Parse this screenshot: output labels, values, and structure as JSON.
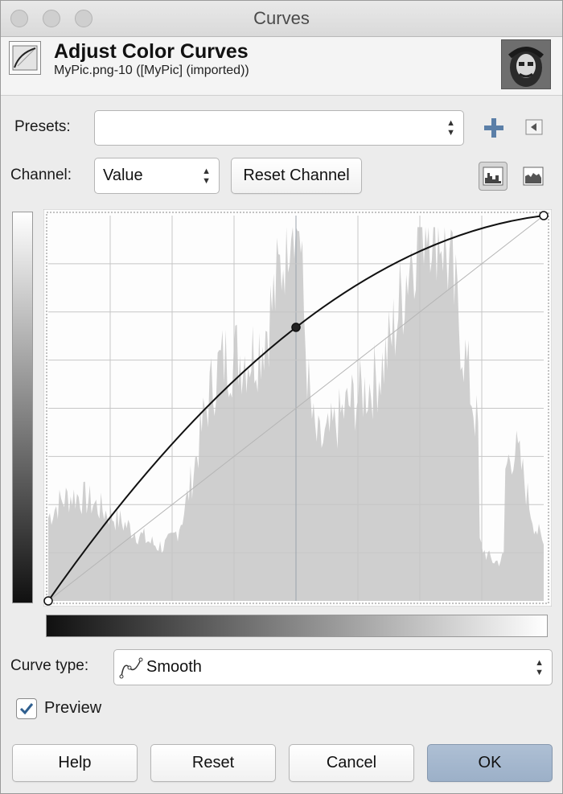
{
  "window": {
    "title": "Curves"
  },
  "header": {
    "title": "Adjust Color Curves",
    "subtitle": "MyPic.png-10 ([MyPic] (imported))"
  },
  "presets": {
    "label": "Presets:",
    "value": ""
  },
  "channel": {
    "label": "Channel:",
    "value": "Value",
    "reset_label": "Reset Channel"
  },
  "curve_type": {
    "label": "Curve type:",
    "value": "Smooth"
  },
  "preview": {
    "label": "Preview",
    "checked": true
  },
  "buttons": {
    "help": "Help",
    "reset": "Reset",
    "cancel": "Cancel",
    "ok": "OK"
  },
  "curve": {
    "control_points": [
      [
        0,
        0
      ],
      [
        0.5,
        0.71
      ],
      [
        1,
        1
      ]
    ],
    "interpolation": "smooth"
  },
  "histogram_peaks_note": "grayscale value histogram",
  "colors": {
    "curve": "#111111",
    "grid": "#c6c6c6",
    "histogram": "#cfcfcf",
    "ok_button": "#a7b9cf"
  },
  "icons": [
    "window-close-icon",
    "curves-tool-icon",
    "image-thumbnail",
    "add-preset-icon",
    "preset-menu-icon",
    "linear-histogram-icon",
    "log-histogram-icon",
    "smooth-curve-icon",
    "check-icon"
  ]
}
